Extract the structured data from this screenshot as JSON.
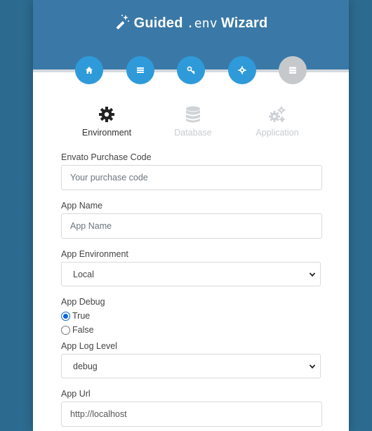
{
  "header": {
    "title_prefix": "Guided",
    "title_mono": ".env",
    "title_suffix": "Wizard",
    "icon": "magic-wand-icon"
  },
  "steps": [
    {
      "icon": "home-icon",
      "state": "active"
    },
    {
      "icon": "list-icon",
      "state": "active"
    },
    {
      "icon": "key-icon",
      "state": "active"
    },
    {
      "icon": "gear-icon",
      "state": "active"
    },
    {
      "icon": "server-icon",
      "state": "inactive"
    }
  ],
  "tabs": [
    {
      "label": "Environment",
      "icon": "gear-icon",
      "state": "active"
    },
    {
      "label": "Database",
      "icon": "database-icon",
      "state": "disabled"
    },
    {
      "label": "Application",
      "icon": "cogs-icon",
      "state": "disabled"
    }
  ],
  "form": {
    "purchase_code": {
      "label": "Envato Purchase Code",
      "placeholder": "Your purchase code",
      "value": ""
    },
    "app_name": {
      "label": "App Name",
      "placeholder": "App Name",
      "value": ""
    },
    "app_environment": {
      "label": "App Environment",
      "selected": "Local"
    },
    "app_debug": {
      "label": "App Debug",
      "options": [
        "True",
        "False"
      ],
      "selected": "True"
    },
    "app_log_level": {
      "label": "App Log Level",
      "selected": "debug"
    },
    "app_url": {
      "label": "App Url",
      "value": "http://localhost"
    }
  },
  "colors": {
    "background": "#2f6f94",
    "header": "#3a79a7",
    "step_active": "#2f9ad9",
    "step_inactive": "#c6c9cc",
    "tab_disabled": "#c8cbcf",
    "radio_selected": "#0a66d6"
  }
}
